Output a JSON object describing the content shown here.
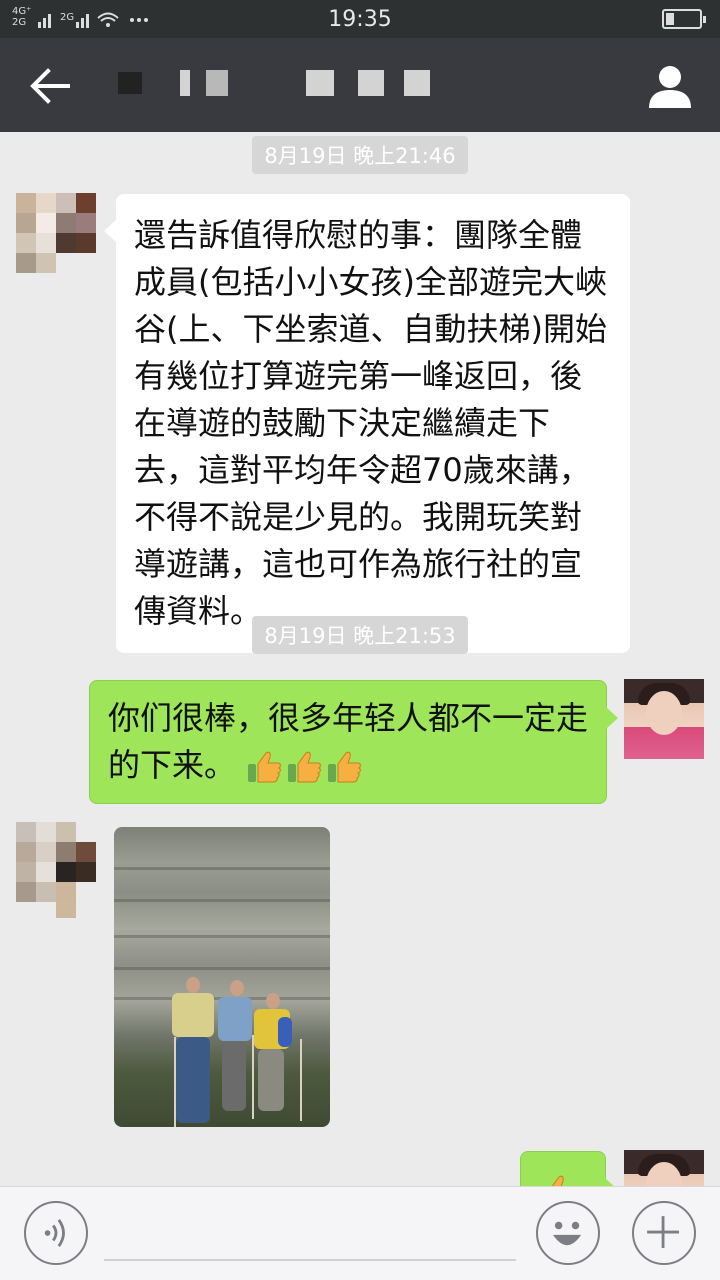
{
  "status_bar": {
    "network_top": "4G⁺",
    "network_bottom": "2G",
    "network2": "2G",
    "time": "19:35",
    "battery_level": 0.25
  },
  "header": {
    "back_icon": "arrow-left-icon",
    "title": "",
    "profile_icon": "person-icon"
  },
  "messages": [
    {
      "type": "timestamp",
      "text": "8月19日 晚上21:46"
    },
    {
      "type": "text",
      "side": "incoming",
      "text": "還告訴值得欣慰的事：團隊全體成員(包括小小女孩)全部遊完大峽谷(上、下坐索道、自動扶梯)開始有幾位打算遊完第一峰返回，後在導遊的鼓勵下決定繼續走下去，這對平均年令超70歲來講，不得不說是少見的。我開玩笑對導遊講，這也可作為旅行社的宣傳資料。"
    },
    {
      "type": "timestamp",
      "text": "8月19日 晚上21:53"
    },
    {
      "type": "text",
      "side": "outgoing",
      "text": "你们很棒，很多年轻人都不一定走的下来。",
      "emoji": [
        "thumbs-up-icon",
        "thumbs-up-icon",
        "thumbs-up-icon"
      ]
    },
    {
      "type": "image",
      "side": "incoming",
      "description": "photo-message"
    },
    {
      "type": "text",
      "side": "outgoing",
      "partial": true,
      "emoji": [
        "thumbs-up-icon"
      ]
    }
  ],
  "input_bar": {
    "voice_icon": "voice-icon",
    "emoji_icon": "smiley-icon",
    "plus_icon": "plus-icon"
  },
  "colors": {
    "header_bg": "#393a3f",
    "chat_bg": "#ebebeb",
    "outgoing_bubble": "#9fe55a",
    "incoming_bubble": "#ffffff"
  }
}
